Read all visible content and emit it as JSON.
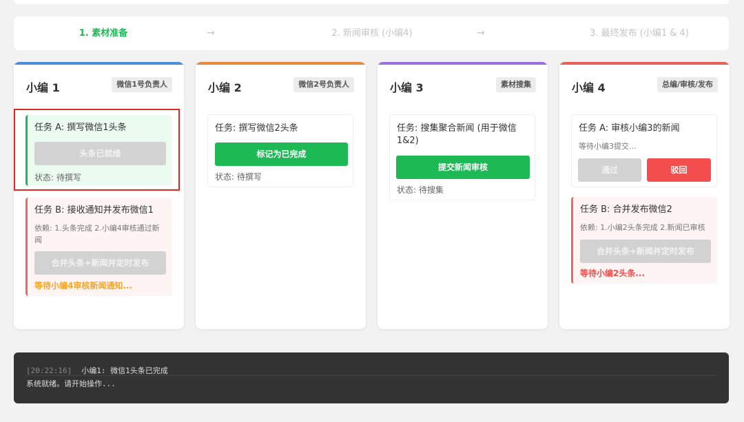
{
  "steps": [
    {
      "label": "1. 素材准备"
    },
    {
      "label": "2. 新闻审核 (小编4)"
    },
    {
      "label": "3. 最终发布 (小编1 & 4)"
    }
  ],
  "arrow": "→",
  "colors": {
    "green": "#1db954",
    "red": "#f24e4e",
    "orange": "#f5a623",
    "blue": "#4a90d9",
    "amber": "#e8893a",
    "purple": "#9b6fe0",
    "coral": "#e8605a"
  },
  "columns": [
    {
      "title": "小编 1",
      "tag": "微信1号负责人",
      "tasks": [
        {
          "title": "任务 A: 撰写微信1头条",
          "button": "头条已就绪",
          "status": "状态: 待撰写"
        },
        {
          "title": "任务 B: 接收通知并发布微信1",
          "desc": "依赖: 1.头条完成 2.小编4审核通过新闻",
          "button": "合并头条+新闻并定时发布",
          "warn": "等待小编4审核新闻通知..."
        }
      ]
    },
    {
      "title": "小编 2",
      "tag": "微信2号负责人",
      "tasks": [
        {
          "title": "任务: 撰写微信2头条",
          "button": "标记为已完成",
          "status": "状态: 待撰写"
        }
      ]
    },
    {
      "title": "小编 3",
      "tag": "素材搜集",
      "tasks": [
        {
          "title": "任务: 搜集聚合新闻 (用于微信1&2)",
          "button": "提交新闻审核",
          "status": "状态: 待搜集"
        }
      ]
    },
    {
      "title": "小编 4",
      "tag": "总编/审核/发布",
      "tasks": [
        {
          "title": "任务 A: 审核小编3的新闻",
          "desc": "等待小编3提交...",
          "approve": "通过",
          "reject": "驳回"
        },
        {
          "title": "任务 B: 合并发布微信2",
          "desc": "依赖: 1.小编2头条完成 2.新闻已审核",
          "button": "合并头条+新闻并定时发布",
          "warn": "等待小编2头条..."
        }
      ]
    }
  ],
  "log": [
    {
      "time": "[20:22:16]",
      "text": "小编1: 微信1头条已完成"
    },
    {
      "text": "系统就绪。请开始操作..."
    }
  ]
}
